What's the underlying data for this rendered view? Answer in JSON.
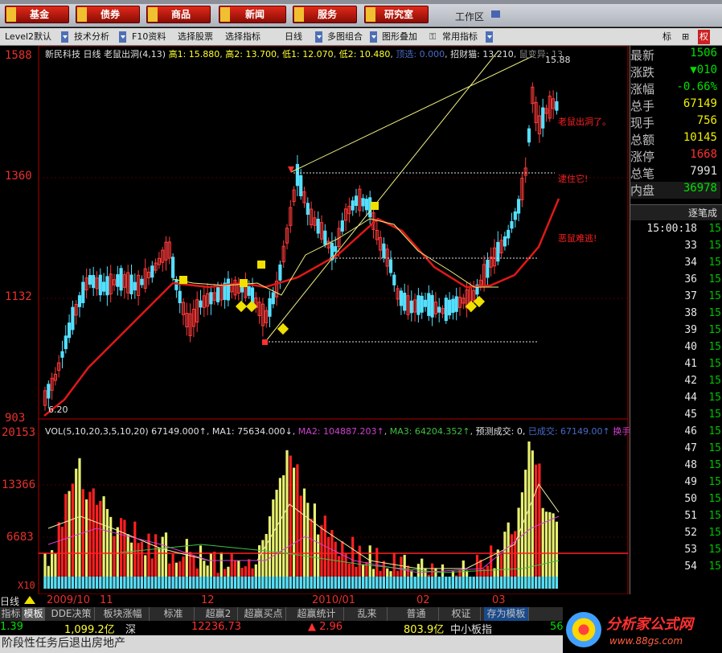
{
  "nav": {
    "buttons": [
      "基金",
      "债券",
      "商品",
      "新闻",
      "服务",
      "研究室"
    ],
    "workzone": "工作区"
  },
  "toolbar": {
    "items": [
      "Level2默认",
      "技术分析",
      "F10资料",
      "选择股票",
      "选择指标",
      "日线",
      "多图组合",
      "图形叠加",
      "常用指标"
    ],
    "right": [
      "标",
      "⊞",
      "权"
    ]
  },
  "stock": {
    "name": "新民科技",
    "period": "日线",
    "indicator": "老鼠出洞(4,13)",
    "h1_label": "高1",
    "h1": "15.880",
    "h2_label": "高2",
    "h2": "13.700",
    "l1_label": "低1",
    "l1": "12.070",
    "l2_label": "低2",
    "l2": "10.480",
    "top_sel": "顶选: 0.000",
    "zhaocai": "招财猫: 13.210",
    "shufly": "鼠变异: 13"
  },
  "axis": {
    "p1": "1588",
    "p2": "1360",
    "p3": "1132",
    "p4": "903",
    "v1": "20153",
    "v2": "13366",
    "v3": "6683",
    "v4": "X10"
  },
  "marks": {
    "high_label": "15.88",
    "low_label": "6.20"
  },
  "annotations": {
    "a1": "老鼠出洞了。",
    "a2": "逮住它!",
    "a3": "恶鼠难逃!"
  },
  "vol": {
    "text": "VOL(5,10,20,3,5,10,20)",
    "v": "67149.000↑",
    "ma1": "MA1: 75634.000↓",
    "ma2": "MA2: 104887.203↑",
    "ma3": "MA3: 64204.352↑",
    "pred": "预测成交: 0,",
    "done": "已成交: 67149.00↑",
    "huan": "换手"
  },
  "timeaxis": {
    "period": "日线",
    "d1": "2009/10",
    "d2": "11",
    "d3": "12",
    "d4": "2010/01",
    "d5": "02",
    "d6": "03"
  },
  "quote": [
    {
      "label": "最新",
      "value": "1506",
      "color": "#00e000"
    },
    {
      "label": "涨跌",
      "value": "▼010",
      "color": "#00e000"
    },
    {
      "label": "涨幅",
      "value": "-0.66%",
      "color": "#00e000"
    },
    {
      "label": "总手",
      "value": "67149",
      "color": "#f0f000"
    },
    {
      "label": "现手",
      "value": "756",
      "color": "#f0f000"
    },
    {
      "label": "总额",
      "value": "10145",
      "color": "#f0f000"
    },
    {
      "label": "涨停",
      "value": "1668",
      "color": "#ff3030"
    },
    {
      "label": "总笔",
      "value": "7991",
      "color": "#e0e0e0"
    },
    {
      "label": "内盘",
      "value": "36978",
      "color": "#00e000"
    }
  ],
  "ticks_header": "逐笔成",
  "ticks": [
    {
      "m": "15:00:18",
      "r": "15"
    },
    {
      "m": "33",
      "r": "15"
    },
    {
      "m": "34",
      "r": "15"
    },
    {
      "m": "36",
      "r": "15"
    },
    {
      "m": "37",
      "r": "15"
    },
    {
      "m": "38",
      "r": "15"
    },
    {
      "m": "39",
      "r": "15"
    },
    {
      "m": "40",
      "r": "15"
    },
    {
      "m": "41",
      "r": "15"
    },
    {
      "m": "42",
      "r": "15"
    },
    {
      "m": "44",
      "r": "15"
    },
    {
      "m": "45",
      "r": "15"
    },
    {
      "m": "46",
      "r": "15"
    },
    {
      "m": "47",
      "r": "15"
    },
    {
      "m": "48",
      "r": "15"
    },
    {
      "m": "49",
      "r": "15"
    },
    {
      "m": "50",
      "r": "15"
    },
    {
      "m": "51",
      "r": "15"
    },
    {
      "m": "52",
      "r": "15"
    },
    {
      "m": "53",
      "r": "15"
    },
    {
      "m": "54",
      "r": "15"
    }
  ],
  "bottom": {
    "tabs": [
      "指标",
      "模板",
      "DDE决策",
      "板块涨幅",
      "标准",
      "超赢2",
      "超赢买点",
      "超赢统计",
      "乱来",
      "普通",
      "权证",
      "存为模板"
    ],
    "idx_left": "1.39",
    "idx_amt": "1,099.2亿",
    "idx_sh": "深",
    "idx_val": "12236.73",
    "idx_chg": "▲ 2.96",
    "idx_amt2": "803.9亿",
    "idx_board": "中小板指",
    "idx_right": "56",
    "ticker": "阶段性任务后退出房地产",
    "watermark": "分析家公式网",
    "watermark_url": "www.88gs.com"
  }
}
